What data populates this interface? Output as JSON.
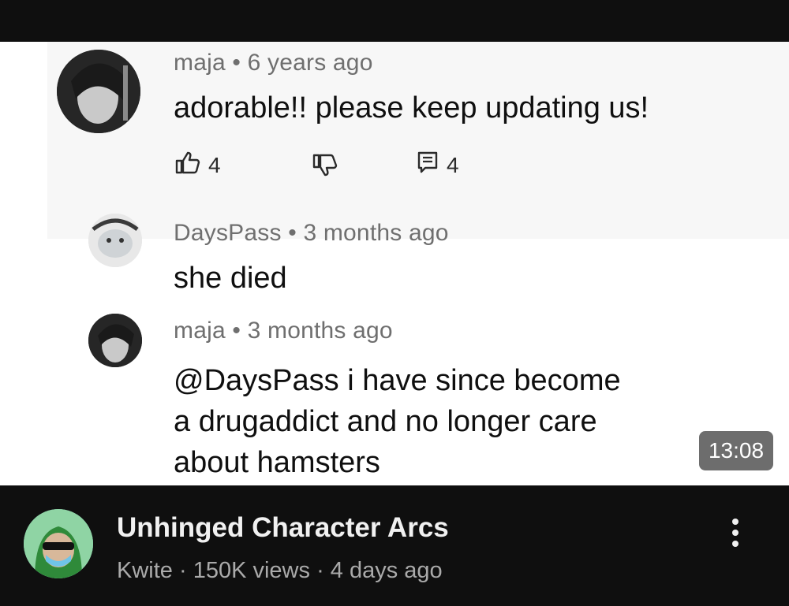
{
  "thumbnail": {
    "comments": [
      {
        "author": "maja",
        "separator": " • ",
        "time": "6 years ago",
        "text": "adorable!! please keep updating us!",
        "likes": "4",
        "replies": "4"
      },
      {
        "author": "DaysPass",
        "separator": " • ",
        "time": "3 months ago",
        "text": "she died"
      },
      {
        "author": "maja",
        "separator": " • ",
        "time": "3 months ago",
        "text_lines": [
          "@DaysPass i have since become",
          "a drugaddict and no longer care",
          "about hamsters"
        ]
      }
    ],
    "duration": "13:08"
  },
  "video": {
    "title": "Unhinged Character Arcs",
    "channel": "Kwite",
    "meta_sep1": " · ",
    "views": "150K views",
    "meta_sep2": " · ",
    "age": "4 days ago"
  },
  "icons": {
    "like": "thumb-up-icon",
    "dislike": "thumb-down-icon",
    "reply": "comment-icon",
    "more": "more-vert-icon"
  },
  "colors": {
    "background": "#0f0f0f",
    "title": "#f1f1f1",
    "meta": "#aaaaaa",
    "duration_badge": "#6d6d6d"
  }
}
